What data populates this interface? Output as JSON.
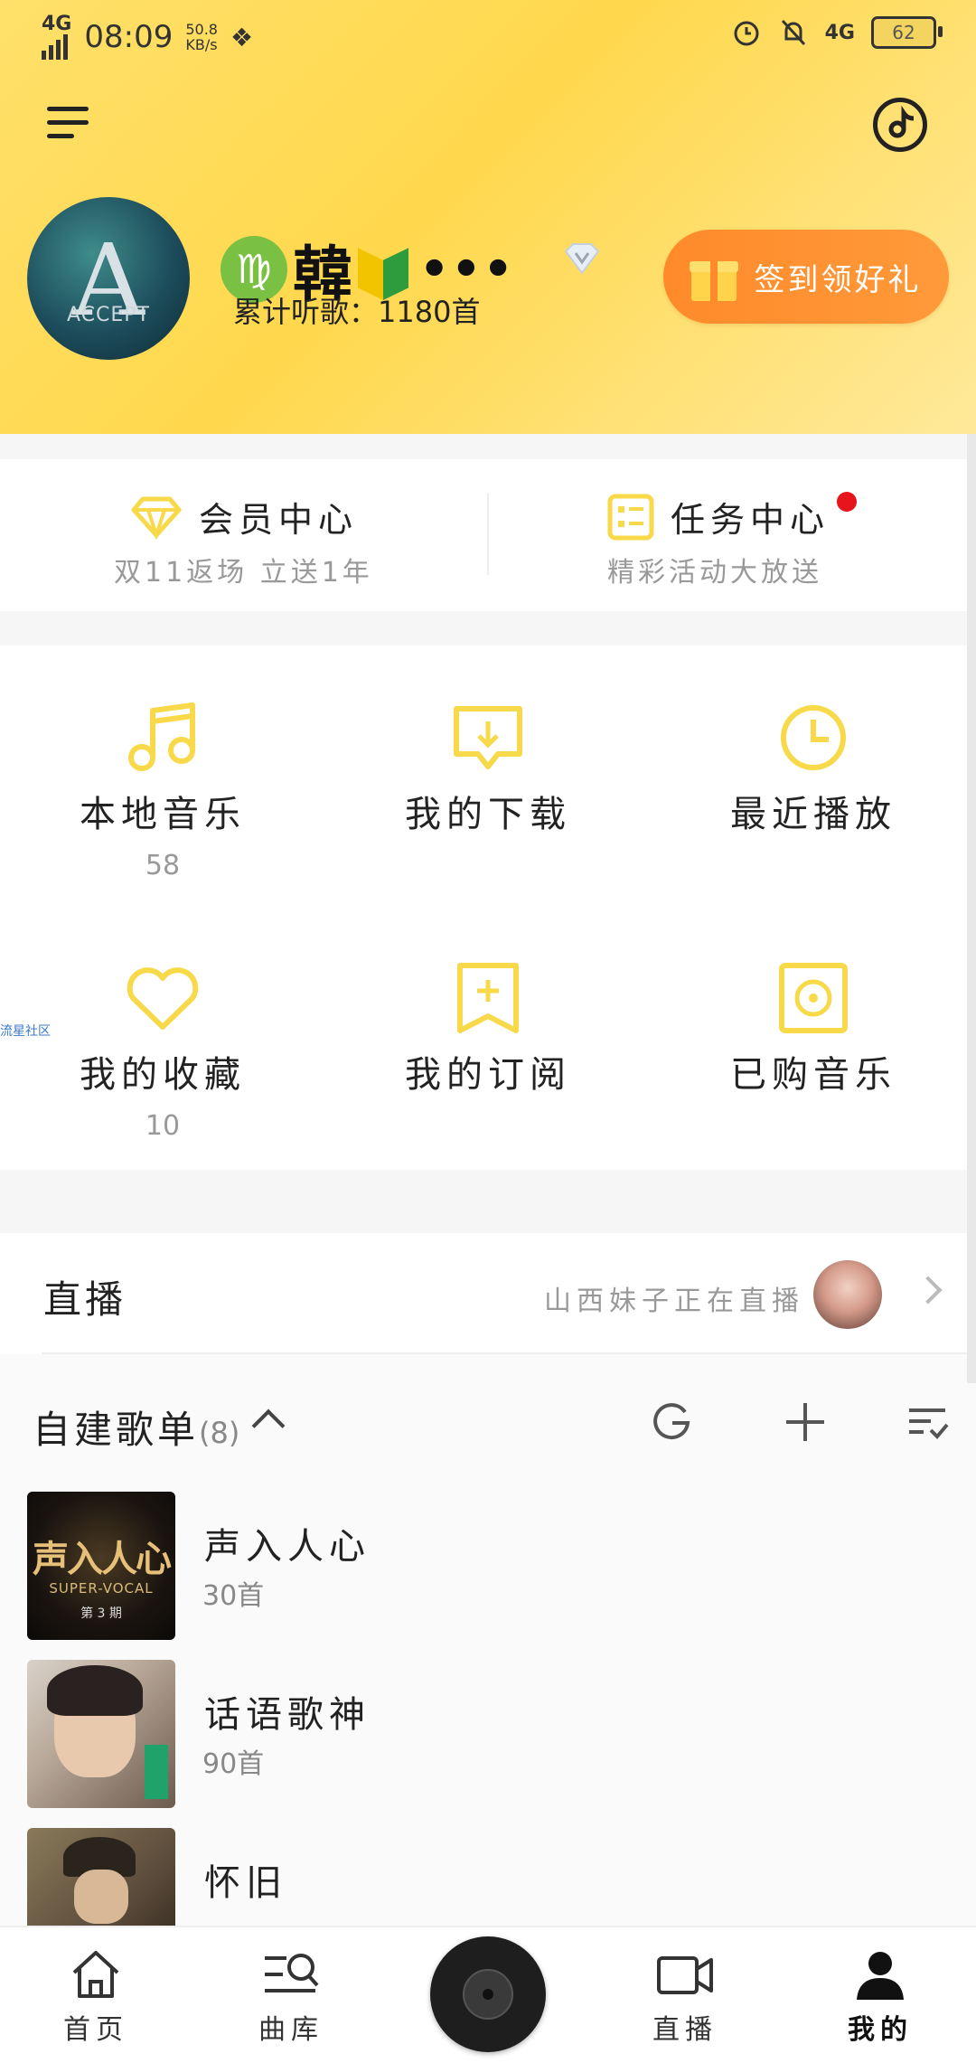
{
  "status_bar": {
    "network": "4G",
    "time": "08:09",
    "speed_value": "50.8",
    "speed_unit": "KB/s",
    "network_right": "4G",
    "battery": "62"
  },
  "profile": {
    "name": "韓",
    "more": "•••",
    "listen_count": "累计听歌：1180首",
    "sign_button": "签到领好礼",
    "avatar_letter": "A",
    "avatar_word": "ACCEPT"
  },
  "member": {
    "title": "会员中心",
    "subtitle": "双11返场 立送1年"
  },
  "task": {
    "title": "任务中心",
    "subtitle": "精彩活动大放送"
  },
  "grid": [
    {
      "label": "本地音乐",
      "count": "58",
      "icon": "music-note-icon"
    },
    {
      "label": "我的下载",
      "count": "",
      "icon": "download-icon"
    },
    {
      "label": "最近播放",
      "count": "",
      "icon": "clock-icon"
    },
    {
      "label": "我的收藏",
      "count": "10",
      "icon": "heart-icon"
    },
    {
      "label": "我的订阅",
      "count": "",
      "icon": "subscribe-icon"
    },
    {
      "label": "已购音乐",
      "count": "",
      "icon": "purchased-icon"
    }
  ],
  "side_tag": "流星社区",
  "live": {
    "title": "直播",
    "text": "山西妹子正在直播"
  },
  "playlists": {
    "title": "自建歌单",
    "count": "(8)",
    "items": [
      {
        "name": "声入人心",
        "songs": "30首",
        "cover_title": "声入人心",
        "cover_sub": "SUPER-VOCAL",
        "cover_issue": "第 3 期"
      },
      {
        "name": "话语歌神",
        "songs": "90首"
      },
      {
        "name": "怀旧",
        "songs": ""
      }
    ]
  },
  "bottom_nav": {
    "home": "首页",
    "library": "曲库",
    "live": "直播",
    "mine": "我的"
  },
  "colors": {
    "accent": "#f7d94a",
    "header_bg": "#ffd84d",
    "sign_button": "#ff8f2e",
    "badge_red": "#e8141b"
  }
}
